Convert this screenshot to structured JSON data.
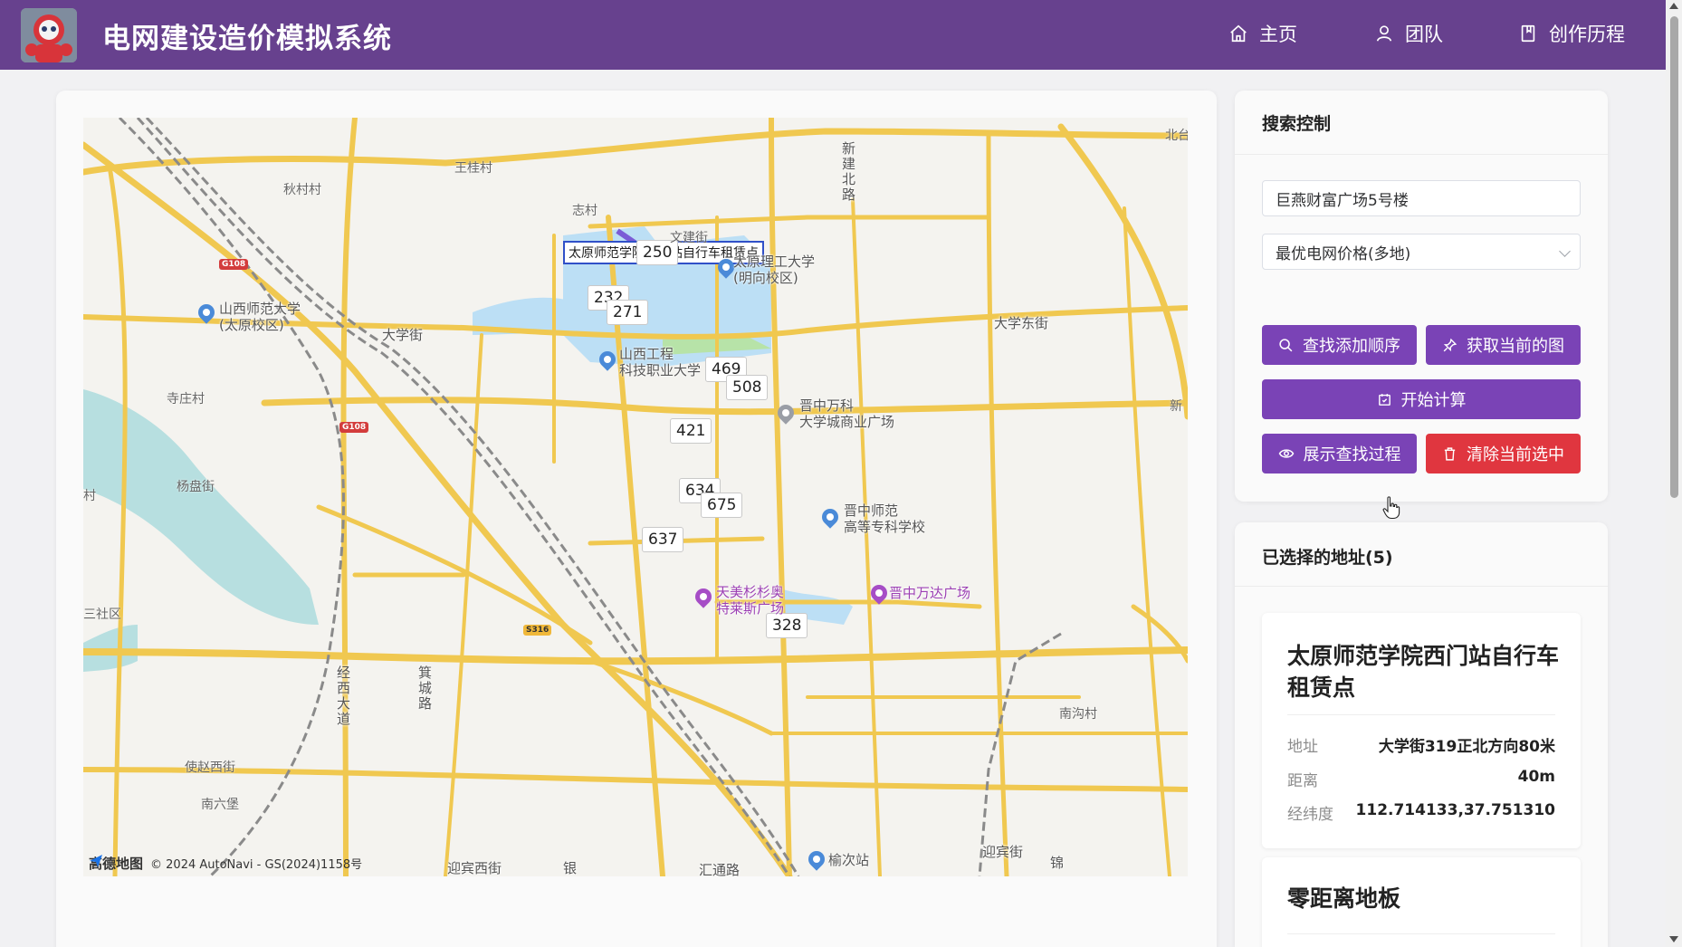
{
  "header": {
    "title": "电网建设造价模拟系统",
    "nav": [
      {
        "label": "主页",
        "icon": "home-icon"
      },
      {
        "label": "团队",
        "icon": "user-icon"
      },
      {
        "label": "创作历程",
        "icon": "book-icon"
      }
    ]
  },
  "map": {
    "info_tip": "太原师范学院西门站自行车租赁点",
    "markers": [
      "250",
      "232",
      "271",
      "469",
      "508",
      "421",
      "634",
      "675",
      "637",
      "328"
    ],
    "pois": {
      "shanxi_normal": "山西师范大学\n(太原校区)",
      "shanxi_eng": "山西工程\n科技职业大学",
      "taiyuan_tech": "太原理工大学\n(明向校区)",
      "wanke": "晋中万科\n大学城商业广场",
      "jinzhong_normal": "晋中师范\n高等专科学校",
      "tianmei": "天美杉杉奥\n特莱斯广场",
      "wanda": "晋中万达广场",
      "yuci": "榆次站"
    },
    "villages": {
      "wangzhu": "王桂村",
      "qiucun": "秋村村",
      "zhicun": "志村",
      "sizhuang": "寺庄村",
      "yangpan": "杨盘街",
      "shequ": "三社区",
      "shizhao": "使赵西街",
      "nanliu": "南六堡",
      "nangou": "南沟村",
      "xin": "新",
      "bei": "北台",
      "cun": "村",
      "wenjian": "文建街"
    },
    "roads": {
      "daxue": "大学街",
      "daxue_east": "大学东街",
      "yingbin_w": "迎宾西街",
      "yingbin": "迎宾街",
      "yin": "银",
      "huitong": "汇通路",
      "jin": "锦",
      "xinjian_n": "新建北路",
      "jingxi": "经西大道",
      "jicheng": "箕城路"
    },
    "shields": [
      "G108",
      "G108",
      "S316"
    ],
    "attribution": {
      "brand": "高德地图",
      "text": "© 2024 AutoNavi - GS(2024)1158号"
    }
  },
  "search": {
    "title": "搜索控制",
    "query": "巨燕财富广场5号楼",
    "mode": "最优电网价格(多地)",
    "buttons": {
      "find_order": "查找添加顺序",
      "get_map": "获取当前的图",
      "start": "开始计算",
      "show_process": "展示查找过程",
      "clear": "清除当前选中"
    }
  },
  "selected": {
    "title": "已选择的地址(5)",
    "items": [
      {
        "name": "太原师范学院西门站自行车租赁点",
        "address_label": "地址",
        "address": "大学街319正北方向80米",
        "distance_label": "距离",
        "distance": "40m",
        "coords_label": "经纬度",
        "coords": "112.714133,37.751310"
      },
      {
        "name": "零距离地板"
      }
    ]
  },
  "colors": {
    "header": "#67418e",
    "button_purple": "#7a43b6",
    "button_red": "#e0363f",
    "road": "#f0c850"
  }
}
